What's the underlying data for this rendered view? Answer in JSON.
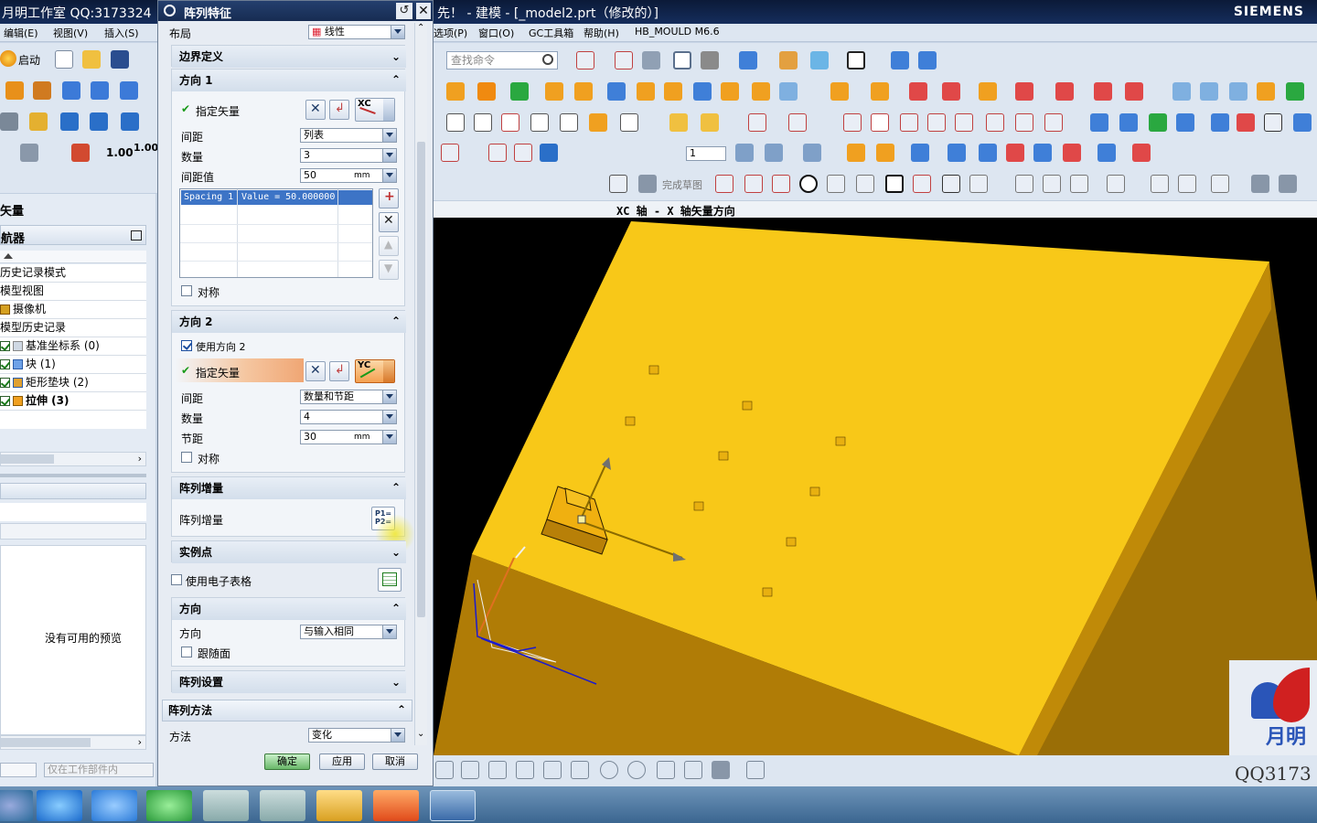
{
  "window": {
    "title_left": "月明工作室 QQ:3173324",
    "title_center": "先！ - 建模 - [_model2.prt（修改的）]",
    "brand": "SIEMENS"
  },
  "menubar": {
    "left": [
      "编辑(E)",
      "视图(V)",
      "插入(S)"
    ],
    "right": [
      "选项(P)",
      "窗口(O)",
      "GC工具箱",
      "帮助(H)",
      "HB_MOULD M6.6"
    ]
  },
  "toolbar": {
    "start_label": "启动",
    "search_placeholder": "查找命令",
    "scale_a": "1.00",
    "scale_b": "1.00",
    "sketch_finish": "完成草图",
    "layer_value": "1"
  },
  "leftpane": {
    "title": "矢量",
    "navigator": "航器",
    "items": [
      {
        "label": "历史记录模式"
      },
      {
        "label": "模型视图"
      },
      {
        "label": "摄像机"
      },
      {
        "label": "模型历史记录"
      },
      {
        "label": "基准坐标系 (0)",
        "checked": true
      },
      {
        "label": "块 (1)",
        "checked": true
      },
      {
        "label": "矩形垫块 (2)",
        "checked": true
      },
      {
        "label": "拉伸 (3)",
        "checked": true
      }
    ],
    "no_preview": "没有可用的预览",
    "filter": "仅在工作部件内"
  },
  "dialog": {
    "title": "阵列特征",
    "layout_label": "布局",
    "layout_value": "线性",
    "boundary": "边界定义",
    "dir1": {
      "title": "方向 1",
      "vector_label": "指定矢量",
      "vector_tag": "XC",
      "spacing_label": "间距",
      "spacing_value": "列表",
      "count_label": "数量",
      "count_value": "3",
      "pitch_label": "间距值",
      "pitch_value": "50",
      "unit": "mm",
      "list_col1": "Spacing 1",
      "list_col2": "Value = 50.000000",
      "symmetric": "对称"
    },
    "dir2": {
      "title": "方向 2",
      "use_label": "使用方向 2",
      "vector_label": "指定矢量",
      "vector_tag": "YC",
      "spacing_label": "间距",
      "spacing_value": "数量和节距",
      "count_label": "数量",
      "count_value": "4",
      "pitch_label": "节距",
      "pitch_value": "30",
      "unit": "mm",
      "symmetric": "对称"
    },
    "increment": {
      "title": "阵列增量",
      "label": "阵列增量"
    },
    "instance": {
      "title": "实例点",
      "spreadsheet": "使用电子表格"
    },
    "orientation": {
      "title": "方向",
      "label": "方向",
      "value": "与输入相同",
      "follow": "跟随面"
    },
    "settings": "阵列设置",
    "method": {
      "title": "阵列方法",
      "label": "方法",
      "value": "变化"
    },
    "ok": "确定",
    "apply": "应用",
    "cancel": "取消"
  },
  "viewport": {
    "hint": "XC 轴 - X 轴矢量方向",
    "watermark": "QQ3173",
    "watermark_logo": "月明"
  },
  "colors": {
    "part_top": "#f8c818",
    "part_side": "#c08a08",
    "part_front": "#9a6e06",
    "viewport_bg": "#000000"
  }
}
